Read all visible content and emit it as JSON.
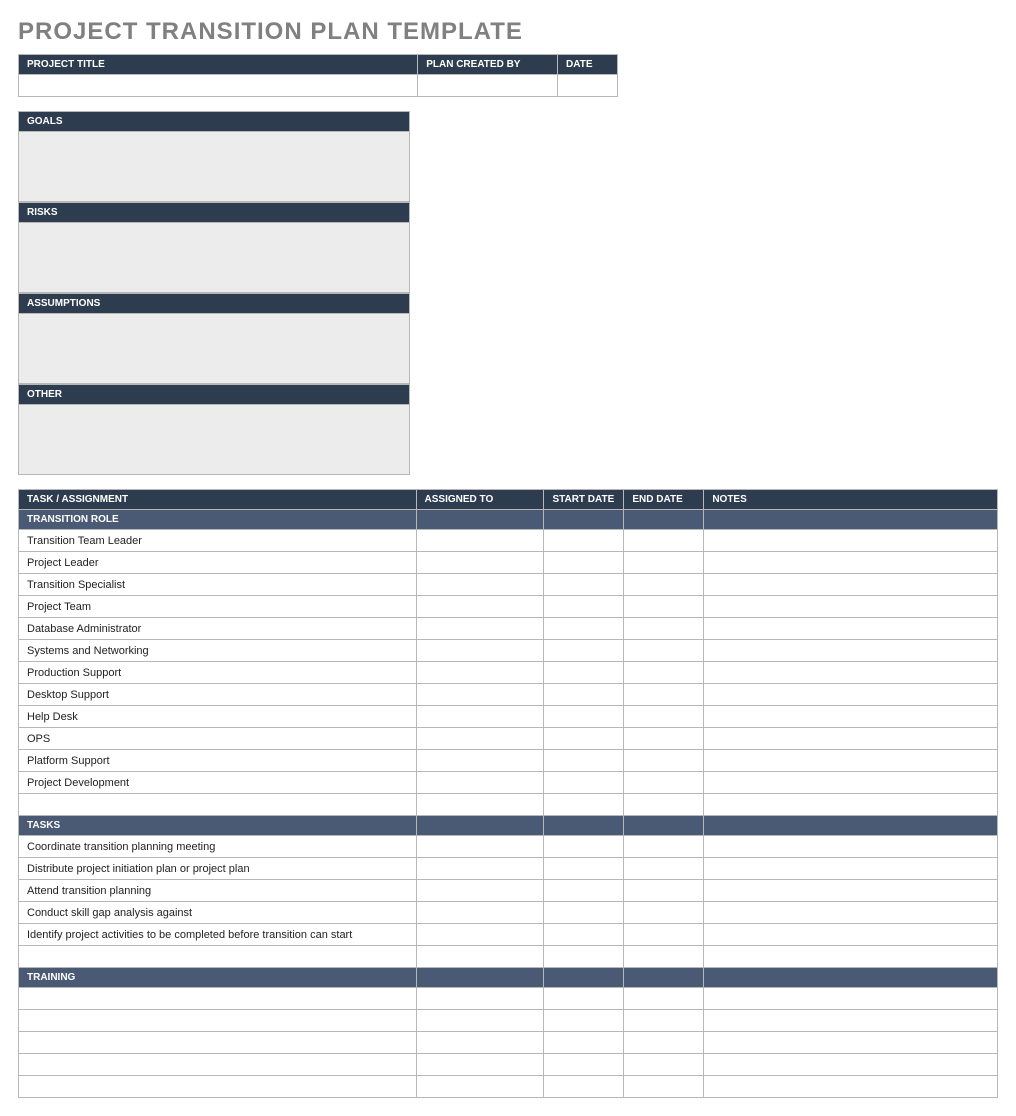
{
  "title": "PROJECT TRANSITION PLAN TEMPLATE",
  "info": {
    "headers": [
      "PROJECT TITLE",
      "PLAN CREATED BY",
      "DATE"
    ],
    "values": [
      "",
      "",
      ""
    ]
  },
  "sections": [
    {
      "label": "GOALS",
      "value": ""
    },
    {
      "label": "RISKS",
      "value": ""
    },
    {
      "label": "ASSUMPTIONS",
      "value": ""
    },
    {
      "label": "OTHER",
      "value": ""
    }
  ],
  "task_headers": [
    "TASK / ASSIGNMENT",
    "ASSIGNED TO",
    "START DATE",
    "END DATE",
    "NOTES"
  ],
  "groups": [
    {
      "label": "TRANSITION ROLE",
      "rows": [
        "Transition Team Leader",
        "Project Leader",
        "Transition Specialist",
        "Project Team",
        "Database Administrator",
        "Systems and Networking",
        "Production Support",
        "Desktop Support",
        "Help Desk",
        "OPS",
        "Platform Support",
        "Project Development"
      ],
      "trailing_blank": 1
    },
    {
      "label": "TASKS",
      "rows": [
        "Coordinate transition planning meeting",
        "Distribute project initiation plan or project plan",
        "Attend transition planning",
        "Conduct skill gap analysis against",
        "Identify project activities to be completed before transition can start"
      ],
      "trailing_blank": 1
    },
    {
      "label": "TRAINING",
      "rows": [
        "",
        "",
        "",
        "",
        ""
      ],
      "trailing_blank": 0
    }
  ]
}
